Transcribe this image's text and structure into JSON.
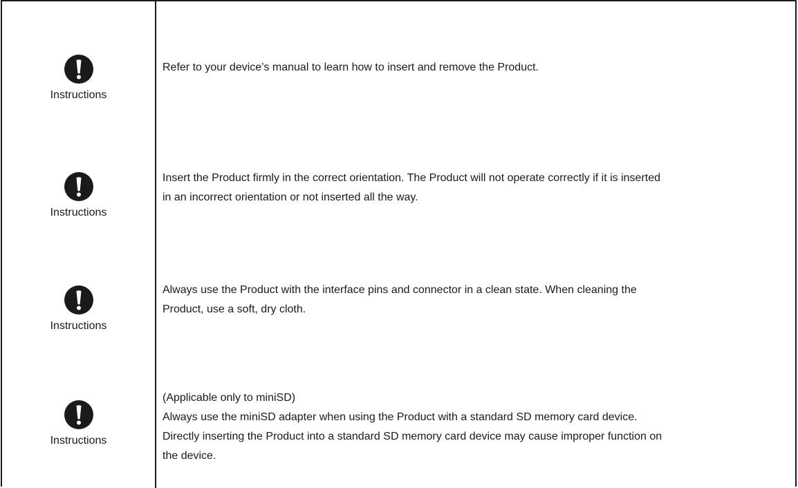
{
  "rows": [
    {
      "icon": "exclamation-circle-icon",
      "label": "Instructions",
      "lines": [
        "Refer to your device’s manual to learn how to insert and remove the Product."
      ]
    },
    {
      "icon": "exclamation-circle-icon",
      "label": "Instructions",
      "lines": [
        "Insert the Product firmly in the correct orientation. The Product will not operate correctly if it is inserted",
        "in an incorrect orientation or not inserted all the way."
      ]
    },
    {
      "icon": "exclamation-circle-icon",
      "label": "Instructions",
      "lines": [
        "Always use the Product with the interface pins and connector in a clean state. When cleaning the",
        "Product, use a soft, dry cloth."
      ]
    },
    {
      "icon": "exclamation-circle-icon",
      "label": "Instructions",
      "lines": [
        "(Applicable only to miniSD)",
        "Always use the miniSD adapter when using the Product with a standard SD memory card device.",
        "Directly inserting the Product into a standard SD memory card device may cause improper function on",
        "the device."
      ]
    }
  ]
}
